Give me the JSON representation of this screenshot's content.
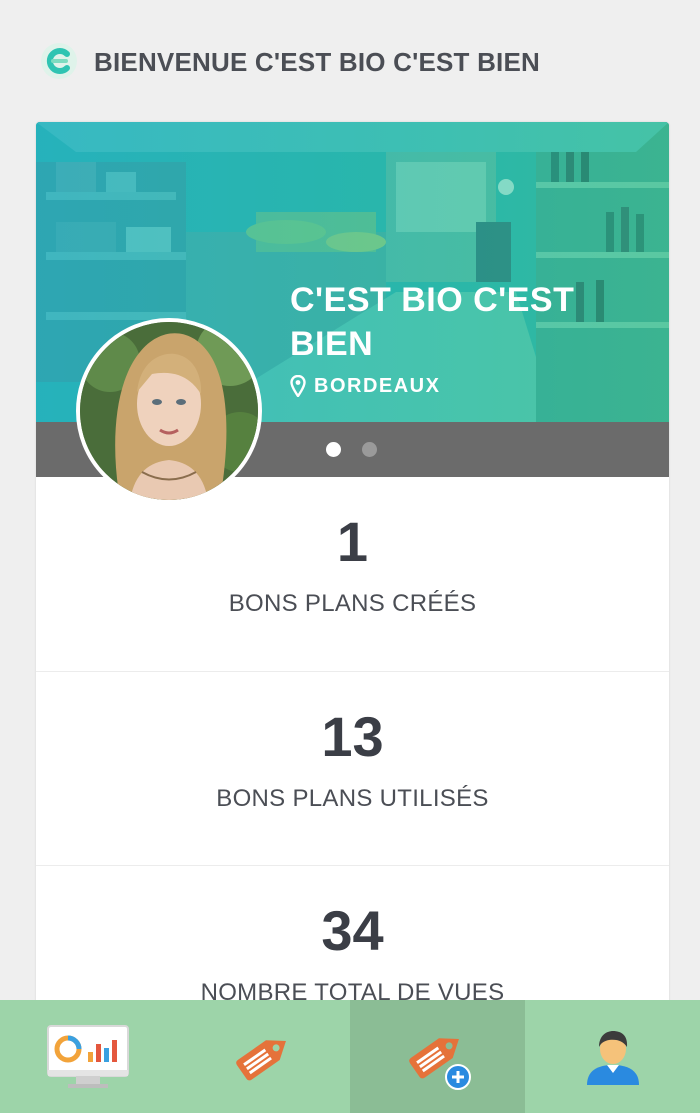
{
  "header": {
    "title": "BIENVENUE C'EST BIO C'EST BIEN"
  },
  "profile": {
    "store_name": "C'EST BIO C'EST BIEN",
    "location": "BORDEAUX",
    "slides": {
      "count": 2,
      "active": 1
    }
  },
  "stats": [
    {
      "value": "1",
      "label": "BONS PLANS CRÉÉS"
    },
    {
      "value": "13",
      "label": "BONS PLANS UTILISÉS"
    },
    {
      "value": "34",
      "label": "NOMBRE TOTAL DE VUES"
    }
  ],
  "tabbar": {
    "active_index": 2,
    "tabs": [
      {
        "icon": "dashboard-chart-icon"
      },
      {
        "icon": "tag-icon"
      },
      {
        "icon": "add-tag-icon"
      },
      {
        "icon": "user-profile-icon"
      }
    ]
  },
  "colors": {
    "accent_green": "#9dd4a9",
    "active_tab": "#8bbd95",
    "tag_orange": "#e5723a",
    "hero_teal": "#2ab7b4",
    "slider_gray": "#6b6b6b"
  }
}
